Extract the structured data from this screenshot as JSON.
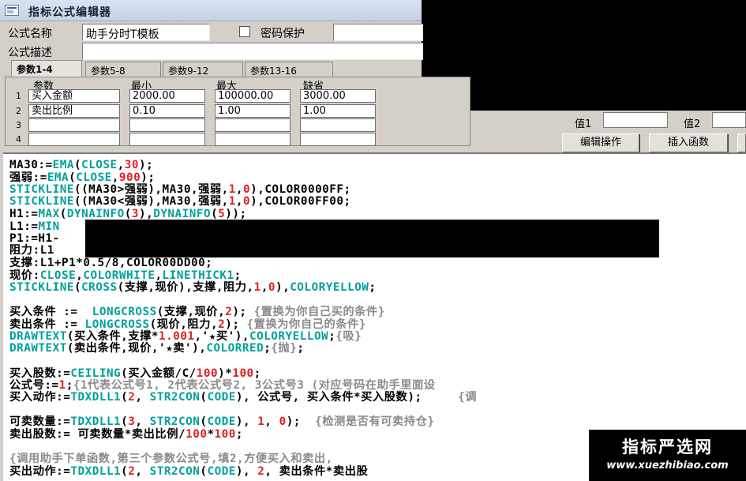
{
  "window": {
    "title": "指标公式编辑器"
  },
  "header": {
    "formula_name_label": "公式名称",
    "formula_name_value": "助手分时T模板",
    "password_label": "密码保护",
    "formula_desc_label": "公式描述"
  },
  "tabs": [
    {
      "label": "参数1-4"
    },
    {
      "label": "参数5-8"
    },
    {
      "label": "参数9-12"
    },
    {
      "label": "参数13-16"
    }
  ],
  "params": {
    "headers": {
      "name": "参数",
      "min": "最小",
      "max": "最大",
      "default": "缺省"
    },
    "rows": [
      {
        "num": "1",
        "name": "买入金额",
        "min": "2000.00",
        "max": "100000.00",
        "default": "3000.00"
      },
      {
        "num": "2",
        "name": "卖出比例",
        "min": "0.10",
        "max": "1.00",
        "default": "1.00"
      },
      {
        "num": "3",
        "name": "",
        "min": "",
        "max": "",
        "default": ""
      },
      {
        "num": "4",
        "name": "",
        "min": "",
        "max": "",
        "default": ""
      }
    ]
  },
  "right_panel": {
    "value1_label": "值1",
    "value2_label": "值2",
    "edit_button": "编辑操作",
    "insert_function_button": "插入函数"
  },
  "code": {
    "lines": [
      [
        {
          "t": "MA30:=",
          "c": "k"
        },
        {
          "t": "EMA",
          "c": "f"
        },
        {
          "t": "(",
          "c": "k"
        },
        {
          "t": "CLOSE",
          "c": "f"
        },
        {
          "t": ",",
          "c": "k"
        },
        {
          "t": "30",
          "c": "n"
        },
        {
          "t": ");",
          "c": "k"
        }
      ],
      [
        {
          "t": "强弱:=",
          "c": "k"
        },
        {
          "t": "EMA",
          "c": "f"
        },
        {
          "t": "(",
          "c": "k"
        },
        {
          "t": "CLOSE",
          "c": "f"
        },
        {
          "t": ",",
          "c": "k"
        },
        {
          "t": "900",
          "c": "n"
        },
        {
          "t": ");",
          "c": "k"
        }
      ],
      [
        {
          "t": "STICKLINE",
          "c": "f"
        },
        {
          "t": "((MA30>强弱),MA30,强弱,",
          "c": "k"
        },
        {
          "t": "1",
          "c": "n"
        },
        {
          "t": ",",
          "c": "k"
        },
        {
          "t": "0",
          "c": "n"
        },
        {
          "t": "),COLOR0000FF;",
          "c": "k"
        }
      ],
      [
        {
          "t": "STICKLINE",
          "c": "f"
        },
        {
          "t": "((MA30<强弱),MA30,强弱,",
          "c": "k"
        },
        {
          "t": "1",
          "c": "n"
        },
        {
          "t": ",",
          "c": "k"
        },
        {
          "t": "0",
          "c": "n"
        },
        {
          "t": "),COLOR00FF00;",
          "c": "k"
        }
      ],
      [
        {
          "t": "H1:=",
          "c": "k"
        },
        {
          "t": "MAX",
          "c": "f"
        },
        {
          "t": "(",
          "c": "k"
        },
        {
          "t": "DYNAINFO",
          "c": "f"
        },
        {
          "t": "(",
          "c": "k"
        },
        {
          "t": "3",
          "c": "n"
        },
        {
          "t": "),",
          "c": "k"
        },
        {
          "t": "DYNAINFO",
          "c": "f"
        },
        {
          "t": "(",
          "c": "k"
        },
        {
          "t": "5",
          "c": "n"
        },
        {
          "t": "));",
          "c": "k"
        }
      ],
      [
        {
          "t": "L1:=",
          "c": "k"
        },
        {
          "t": "MIN",
          "c": "f"
        }
      ],
      [
        {
          "t": "P1:=H1-",
          "c": "k"
        }
      ],
      [
        {
          "t": "阻力:L1",
          "c": "k"
        }
      ],
      [
        {
          "t": "支撑:L1+P1*0.5/8,COLOR00DD00;",
          "c": "k"
        }
      ],
      [
        {
          "t": "现价:",
          "c": "k"
        },
        {
          "t": "CLOSE",
          "c": "f"
        },
        {
          "t": ",",
          "c": "k"
        },
        {
          "t": "COLORWHITE",
          "c": "f"
        },
        {
          "t": ",",
          "c": "k"
        },
        {
          "t": "LINETHICK1",
          "c": "f"
        },
        {
          "t": ";",
          "c": "k"
        }
      ],
      [
        {
          "t": "STICKLINE",
          "c": "f"
        },
        {
          "t": "(",
          "c": "k"
        },
        {
          "t": "CROSS",
          "c": "f"
        },
        {
          "t": "(支撑,现价),支撑,阻力,",
          "c": "k"
        },
        {
          "t": "1",
          "c": "n"
        },
        {
          "t": ",",
          "c": "k"
        },
        {
          "t": "0",
          "c": "n"
        },
        {
          "t": "),",
          "c": "k"
        },
        {
          "t": "COLORYELLOW",
          "c": "f"
        },
        {
          "t": ";",
          "c": "k"
        }
      ],
      [],
      [
        {
          "t": "买入条件 :=  ",
          "c": "k"
        },
        {
          "t": "LONGCROSS",
          "c": "f"
        },
        {
          "t": "(支撑,现价,",
          "c": "k"
        },
        {
          "t": "2",
          "c": "n"
        },
        {
          "t": "); ",
          "c": "k"
        },
        {
          "t": "{置换为你自己买的条件}",
          "c": "g"
        }
      ],
      [
        {
          "t": "卖出条件 := ",
          "c": "k"
        },
        {
          "t": "LONGCROSS",
          "c": "f"
        },
        {
          "t": "(现价,阻力,",
          "c": "k"
        },
        {
          "t": "2",
          "c": "n"
        },
        {
          "t": "); ",
          "c": "k"
        },
        {
          "t": "{置换为你自己的条件}",
          "c": "g"
        }
      ],
      [
        {
          "t": "DRAWTEXT",
          "c": "f"
        },
        {
          "t": "(买入条件,支撑*",
          "c": "k"
        },
        {
          "t": "1.001",
          "c": "n"
        },
        {
          "t": ",'★买'),",
          "c": "k"
        },
        {
          "t": "COLORYELLOW",
          "c": "f"
        },
        {
          "t": ";",
          "c": "k"
        },
        {
          "t": "{吸}",
          "c": "g"
        }
      ],
      [
        {
          "t": "DRAWTEXT",
          "c": "f"
        },
        {
          "t": "(卖出条件,现价,'★卖'),",
          "c": "k"
        },
        {
          "t": "COLORRED",
          "c": "f"
        },
        {
          "t": ";",
          "c": "k"
        },
        {
          "t": "{抛}",
          "c": "g"
        },
        {
          "t": ";",
          "c": "k"
        }
      ],
      [],
      [
        {
          "t": "买入股数:=",
          "c": "k"
        },
        {
          "t": "CEILING",
          "c": "f"
        },
        {
          "t": "(买入金额/C/",
          "c": "k"
        },
        {
          "t": "100",
          "c": "n"
        },
        {
          "t": ")*",
          "c": "k"
        },
        {
          "t": "100",
          "c": "n"
        },
        {
          "t": ";",
          "c": "k"
        }
      ],
      [
        {
          "t": "公式号:=",
          "c": "k"
        },
        {
          "t": "1",
          "c": "n"
        },
        {
          "t": ";",
          "c": "k"
        },
        {
          "t": "{1代表公式号1, 2代表公式号2, 3公式号3 (对应号码在助手里面设",
          "c": "g"
        }
      ],
      [
        {
          "t": "买入动作:=",
          "c": "k"
        },
        {
          "t": "TDXDLL1",
          "c": "f"
        },
        {
          "t": "(",
          "c": "k"
        },
        {
          "t": "2",
          "c": "n"
        },
        {
          "t": ", ",
          "c": "k"
        },
        {
          "t": "STR2CON",
          "c": "f"
        },
        {
          "t": "(",
          "c": "k"
        },
        {
          "t": "CODE",
          "c": "f"
        },
        {
          "t": "), 公式号, 买入条件*买入股数);     ",
          "c": "k"
        },
        {
          "t": "{调",
          "c": "g"
        }
      ],
      [],
      [
        {
          "t": "可卖数量:=",
          "c": "k"
        },
        {
          "t": "TDXDLL1",
          "c": "f"
        },
        {
          "t": "(",
          "c": "k"
        },
        {
          "t": "3",
          "c": "n"
        },
        {
          "t": ", ",
          "c": "k"
        },
        {
          "t": "STR2CON",
          "c": "f"
        },
        {
          "t": "(",
          "c": "k"
        },
        {
          "t": "CODE",
          "c": "f"
        },
        {
          "t": "), ",
          "c": "k"
        },
        {
          "t": "1",
          "c": "n"
        },
        {
          "t": ", ",
          "c": "k"
        },
        {
          "t": "0",
          "c": "n"
        },
        {
          "t": ");  ",
          "c": "k"
        },
        {
          "t": "{检测是否有可卖持仓}",
          "c": "g"
        }
      ],
      [
        {
          "t": "卖出股数:= 可卖数量*卖出比例/",
          "c": "k"
        },
        {
          "t": "100",
          "c": "n"
        },
        {
          "t": "*",
          "c": "k"
        },
        {
          "t": "100",
          "c": "n"
        },
        {
          "t": ";",
          "c": "k"
        }
      ],
      [],
      [
        {
          "t": "{调用助手下单函数,第三个参数公式号,填2,方便买入和卖出,",
          "c": "g"
        }
      ],
      [
        {
          "t": "买出动作:=",
          "c": "k"
        },
        {
          "t": "TDXDLL1",
          "c": "f"
        },
        {
          "t": "(",
          "c": "k"
        },
        {
          "t": "2",
          "c": "n"
        },
        {
          "t": ", ",
          "c": "k"
        },
        {
          "t": "STR2CON",
          "c": "f"
        },
        {
          "t": "(",
          "c": "k"
        },
        {
          "t": "CODE",
          "c": "f"
        },
        {
          "t": "), ",
          "c": "k"
        },
        {
          "t": "2",
          "c": "n"
        },
        {
          "t": ", 卖出条件*卖出股",
          "c": "k"
        }
      ]
    ]
  },
  "watermark": {
    "cn": "指标严选网",
    "url": "www.xuezhibiao.com"
  },
  "colors": {
    "keyword": "#000000",
    "function": "#00a09c",
    "number": "#e02020",
    "comment": "#8a8a8a"
  }
}
